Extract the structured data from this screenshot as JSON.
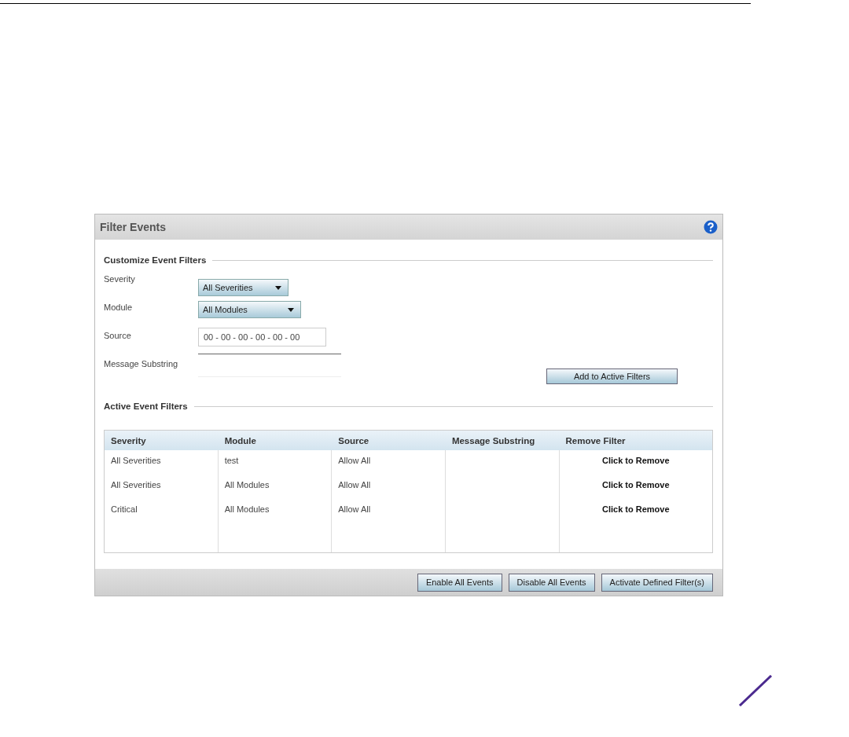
{
  "panel": {
    "title": "Filter Events"
  },
  "customize": {
    "heading": "Customize Event Filters",
    "fields": [
      {
        "kind": "select",
        "label": "Severity",
        "value": "All Severities"
      },
      {
        "kind": "select",
        "label": "Module",
        "value": "All Modules"
      },
      {
        "kind": "text",
        "label": "Source",
        "value": "00 - 00 - 00 - 00 - 00 - 00"
      },
      {
        "kind": "line",
        "label": "Message Substring"
      }
    ],
    "add_button": "Add to Active Filters"
  },
  "active": {
    "heading": "Active Event Filters",
    "columns": [
      "Severity",
      "Module",
      "Source",
      "Message Substring",
      "Remove Filter"
    ],
    "rows": [
      [
        "All Severities",
        "test",
        "Allow All",
        "",
        "Click to Remove"
      ],
      [
        "All Severities",
        "All Modules",
        "Allow All",
        "",
        "Click to Remove"
      ],
      [
        "Critical",
        "All Modules",
        "Allow All",
        "",
        "Click to Remove"
      ]
    ]
  },
  "footer_buttons": [
    "Enable All Events",
    "Disable All Events",
    "Activate Defined Filter(s)"
  ]
}
